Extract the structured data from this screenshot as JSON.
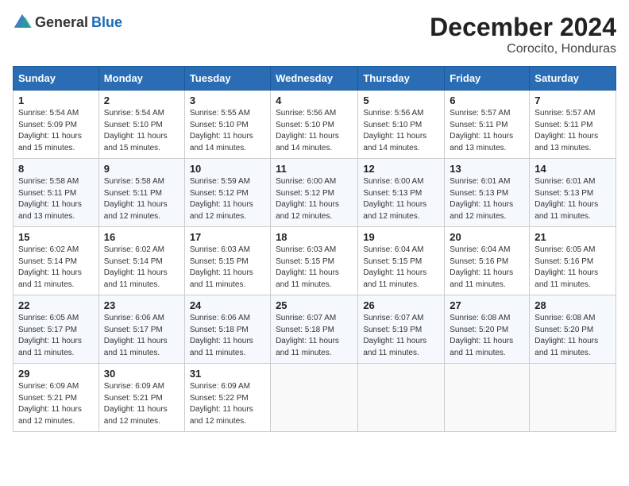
{
  "header": {
    "logo_general": "General",
    "logo_blue": "Blue",
    "month_year": "December 2024",
    "location": "Corocito, Honduras"
  },
  "weekdays": [
    "Sunday",
    "Monday",
    "Tuesday",
    "Wednesday",
    "Thursday",
    "Friday",
    "Saturday"
  ],
  "weeks": [
    [
      {
        "day": "1",
        "sunrise": "5:54 AM",
        "sunset": "5:09 PM",
        "daylight": "11 hours and 15 minutes."
      },
      {
        "day": "2",
        "sunrise": "5:54 AM",
        "sunset": "5:10 PM",
        "daylight": "11 hours and 15 minutes."
      },
      {
        "day": "3",
        "sunrise": "5:55 AM",
        "sunset": "5:10 PM",
        "daylight": "11 hours and 14 minutes."
      },
      {
        "day": "4",
        "sunrise": "5:56 AM",
        "sunset": "5:10 PM",
        "daylight": "11 hours and 14 minutes."
      },
      {
        "day": "5",
        "sunrise": "5:56 AM",
        "sunset": "5:10 PM",
        "daylight": "11 hours and 14 minutes."
      },
      {
        "day": "6",
        "sunrise": "5:57 AM",
        "sunset": "5:11 PM",
        "daylight": "11 hours and 13 minutes."
      },
      {
        "day": "7",
        "sunrise": "5:57 AM",
        "sunset": "5:11 PM",
        "daylight": "11 hours and 13 minutes."
      }
    ],
    [
      {
        "day": "8",
        "sunrise": "5:58 AM",
        "sunset": "5:11 PM",
        "daylight": "11 hours and 13 minutes."
      },
      {
        "day": "9",
        "sunrise": "5:58 AM",
        "sunset": "5:11 PM",
        "daylight": "11 hours and 12 minutes."
      },
      {
        "day": "10",
        "sunrise": "5:59 AM",
        "sunset": "5:12 PM",
        "daylight": "11 hours and 12 minutes."
      },
      {
        "day": "11",
        "sunrise": "6:00 AM",
        "sunset": "5:12 PM",
        "daylight": "11 hours and 12 minutes."
      },
      {
        "day": "12",
        "sunrise": "6:00 AM",
        "sunset": "5:13 PM",
        "daylight": "11 hours and 12 minutes."
      },
      {
        "day": "13",
        "sunrise": "6:01 AM",
        "sunset": "5:13 PM",
        "daylight": "11 hours and 12 minutes."
      },
      {
        "day": "14",
        "sunrise": "6:01 AM",
        "sunset": "5:13 PM",
        "daylight": "11 hours and 11 minutes."
      }
    ],
    [
      {
        "day": "15",
        "sunrise": "6:02 AM",
        "sunset": "5:14 PM",
        "daylight": "11 hours and 11 minutes."
      },
      {
        "day": "16",
        "sunrise": "6:02 AM",
        "sunset": "5:14 PM",
        "daylight": "11 hours and 11 minutes."
      },
      {
        "day": "17",
        "sunrise": "6:03 AM",
        "sunset": "5:15 PM",
        "daylight": "11 hours and 11 minutes."
      },
      {
        "day": "18",
        "sunrise": "6:03 AM",
        "sunset": "5:15 PM",
        "daylight": "11 hours and 11 minutes."
      },
      {
        "day": "19",
        "sunrise": "6:04 AM",
        "sunset": "5:15 PM",
        "daylight": "11 hours and 11 minutes."
      },
      {
        "day": "20",
        "sunrise": "6:04 AM",
        "sunset": "5:16 PM",
        "daylight": "11 hours and 11 minutes."
      },
      {
        "day": "21",
        "sunrise": "6:05 AM",
        "sunset": "5:16 PM",
        "daylight": "11 hours and 11 minutes."
      }
    ],
    [
      {
        "day": "22",
        "sunrise": "6:05 AM",
        "sunset": "5:17 PM",
        "daylight": "11 hours and 11 minutes."
      },
      {
        "day": "23",
        "sunrise": "6:06 AM",
        "sunset": "5:17 PM",
        "daylight": "11 hours and 11 minutes."
      },
      {
        "day": "24",
        "sunrise": "6:06 AM",
        "sunset": "5:18 PM",
        "daylight": "11 hours and 11 minutes."
      },
      {
        "day": "25",
        "sunrise": "6:07 AM",
        "sunset": "5:18 PM",
        "daylight": "11 hours and 11 minutes."
      },
      {
        "day": "26",
        "sunrise": "6:07 AM",
        "sunset": "5:19 PM",
        "daylight": "11 hours and 11 minutes."
      },
      {
        "day": "27",
        "sunrise": "6:08 AM",
        "sunset": "5:20 PM",
        "daylight": "11 hours and 11 minutes."
      },
      {
        "day": "28",
        "sunrise": "6:08 AM",
        "sunset": "5:20 PM",
        "daylight": "11 hours and 11 minutes."
      }
    ],
    [
      {
        "day": "29",
        "sunrise": "6:09 AM",
        "sunset": "5:21 PM",
        "daylight": "11 hours and 12 minutes."
      },
      {
        "day": "30",
        "sunrise": "6:09 AM",
        "sunset": "5:21 PM",
        "daylight": "11 hours and 12 minutes."
      },
      {
        "day": "31",
        "sunrise": "6:09 AM",
        "sunset": "5:22 PM",
        "daylight": "11 hours and 12 minutes."
      },
      null,
      null,
      null,
      null
    ]
  ],
  "labels": {
    "sunrise": "Sunrise:",
    "sunset": "Sunset:",
    "daylight": "Daylight hours"
  }
}
